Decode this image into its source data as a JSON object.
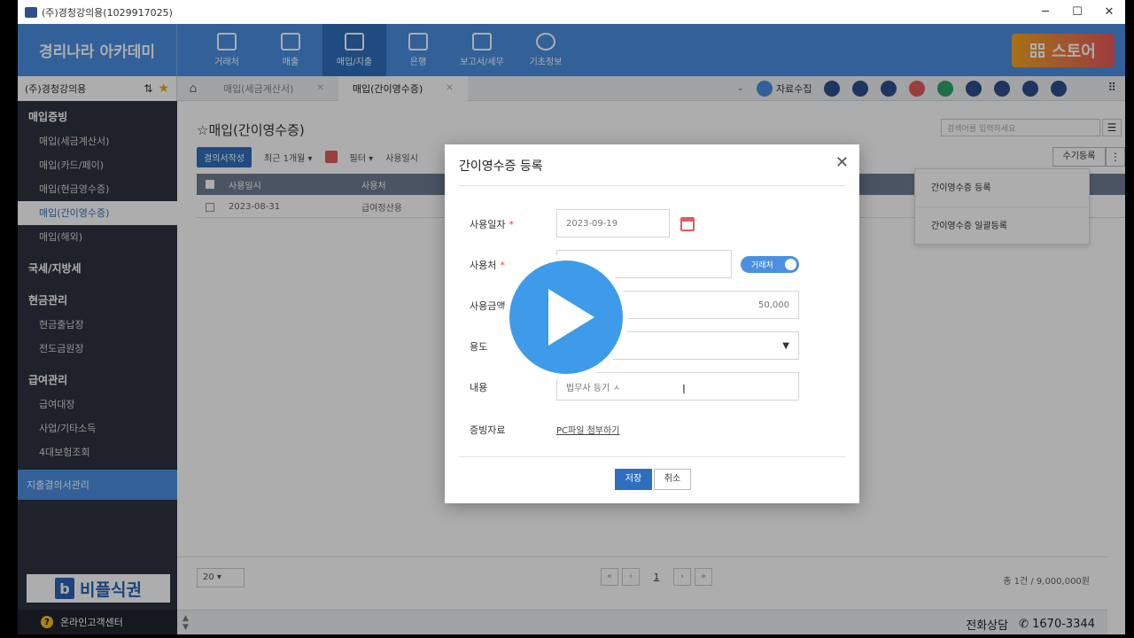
{
  "window": {
    "title": "(주)경청강의용(1029917025)",
    "controls": [
      "─",
      "☐",
      "✕"
    ]
  },
  "brand": "경리나라 아카데미",
  "topnav": [
    {
      "label": "거래처",
      "icon": "building-icon"
    },
    {
      "label": "매출",
      "icon": "sales-icon"
    },
    {
      "label": "매입/지출",
      "icon": "purchase-icon",
      "active": true
    },
    {
      "label": "은행",
      "icon": "bank-icon"
    },
    {
      "label": "보고서/세무",
      "icon": "report-icon"
    },
    {
      "label": "기초정보",
      "icon": "gear-icon"
    }
  ],
  "store_label": "스토어",
  "company_name": "(주)경청강의용",
  "company_sort": "⇅",
  "tabs": [
    {
      "label": "매입(세금계산서)",
      "active": false
    },
    {
      "label": "매입(간이영수증)",
      "active": true
    }
  ],
  "collect_label": "자료수집",
  "tool_icon_colors": [
    "#4a90e2",
    "#2d4f8c",
    "#2d4f8c",
    "#2d4f8c",
    "#e35a5a",
    "#2ea56b",
    "#2d4f8c",
    "#2d4f8c",
    "#2d4f8c",
    "#2d4f8c"
  ],
  "sidebar": {
    "sections": [
      {
        "title": "매입증빙",
        "items": [
          "매입(세금계산서)",
          "매입(카드/페이)",
          "매입(현금영수증)",
          "매입(간이영수증)",
          "매입(해외)"
        ]
      },
      {
        "title": "국세/지방세",
        "items": []
      },
      {
        "title": "현금관리",
        "items": [
          "현금출납장",
          "전도금원장"
        ]
      },
      {
        "title": "급여관리",
        "items": [
          "급여대장",
          "사업/기타소득",
          "4대보험조회"
        ]
      }
    ],
    "active_item": "매입(간이영수증)",
    "highlight": "지출결의서관리",
    "logo_text": "비플식권",
    "logo_letter": "b",
    "help": "온라인고객센터"
  },
  "page": {
    "title": "매입(간이영수증)",
    "search_placeholder": "검색어를 입력하세요",
    "toolbar": {
      "create_btn": "결의서작성",
      "period": "최근 1개월",
      "filter": "필터",
      "date_type": "사용일시"
    },
    "manual_btn": "수기등록",
    "grid_headers": [
      "사용일시",
      "사용처"
    ],
    "grid_rows": [
      {
        "date": "2023-08-31",
        "place": "급여정산용"
      }
    ],
    "dropdown": [
      "간이영수증 등록",
      "간이영수증 일괄등록"
    ],
    "page_size": "20",
    "page_number": "1",
    "total": "총 1건 / 9,000,000원"
  },
  "modal": {
    "title": "간이영수증 등록",
    "fields": {
      "date_label": "사용일자",
      "date_value": "2023-09-19",
      "place_label": "사용처",
      "place_toggle": "거래처",
      "amount_label": "사용금액",
      "amount_value": "50,000",
      "purpose_label": "용도",
      "content_label": "내용",
      "content_value": "법무사 등기 ㅅ",
      "attach_label": "증빙자료",
      "attach_link": "PC파일 첨부하기"
    },
    "save": "저장",
    "cancel": "취소"
  },
  "status": {
    "phone_label": "전화상담",
    "phone_number": "1670-3344"
  }
}
